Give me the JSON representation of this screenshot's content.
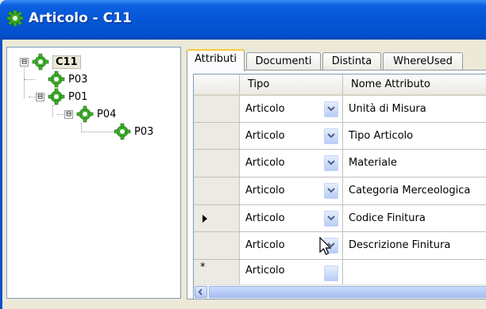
{
  "window": {
    "title": "Articolo - C11",
    "icon": "gear-icon"
  },
  "tree": {
    "root": {
      "label": "C11",
      "expander": "⊟"
    },
    "children": [
      {
        "label": "P03"
      },
      {
        "label": "P01",
        "expander": "⊟"
      },
      {
        "label": "P04",
        "expander": "⊟"
      },
      {
        "label": "P03"
      }
    ]
  },
  "tabs": [
    {
      "label": "Attributi",
      "active": true
    },
    {
      "label": "Documenti"
    },
    {
      "label": "Distinta"
    },
    {
      "label": "WhereUsed"
    }
  ],
  "grid": {
    "columns": [
      "Tipo",
      "Nome Attributo"
    ],
    "rows": [
      {
        "tipo": "Articolo",
        "nome": "Unità di Misura"
      },
      {
        "tipo": "Articolo",
        "nome": "Tipo Articolo"
      },
      {
        "tipo": "Articolo",
        "nome": "Materiale"
      },
      {
        "tipo": "Articolo",
        "nome": "Categoria Merceologica"
      },
      {
        "tipo": "Articolo",
        "nome": "Codice Finitura",
        "current": true
      },
      {
        "tipo": "Articolo",
        "nome": "Descrizione Finitura"
      }
    ],
    "new_row_marker": "*",
    "new_row_tipo": "Articolo"
  },
  "colors": {
    "titlebar": "#0556d6",
    "accent_tab": "#ffc83c",
    "gear_green": "#3fae2a"
  }
}
